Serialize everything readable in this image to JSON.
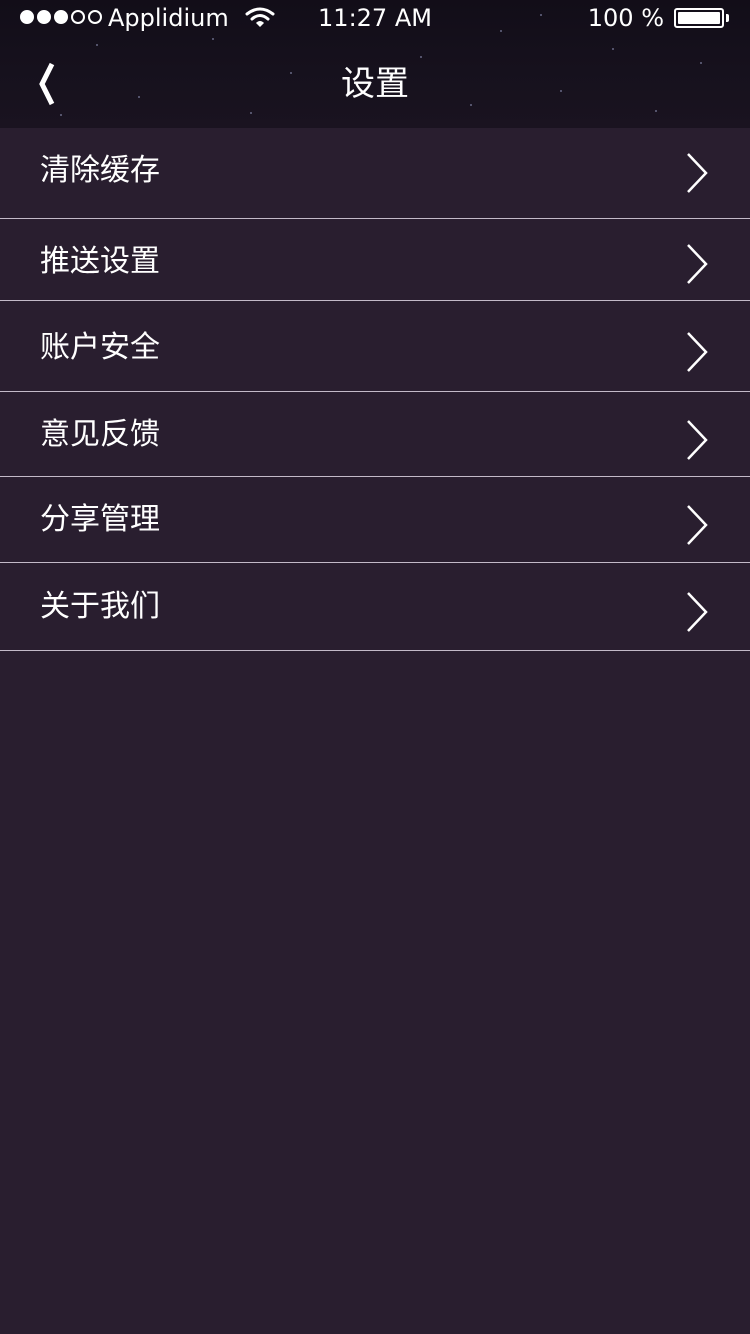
{
  "status_bar": {
    "carrier": "Applidium",
    "time": "11:27 AM",
    "battery": "100 %",
    "signal_bars_filled": 3,
    "signal_bars_total": 5
  },
  "nav": {
    "title": "设置",
    "back_icon": "chevron-left-icon"
  },
  "menu": {
    "items": [
      {
        "label": "清除缓存",
        "icon": "chevron-right-icon"
      },
      {
        "label": "推送设置",
        "icon": "chevron-right-icon"
      },
      {
        "label": "账户安全",
        "icon": "chevron-right-icon"
      },
      {
        "label": "意见反馈",
        "icon": "chevron-right-icon"
      },
      {
        "label": "分享管理",
        "icon": "chevron-right-icon"
      },
      {
        "label": "关于我们",
        "icon": "chevron-right-icon"
      }
    ]
  },
  "colors": {
    "background": "#291e2f",
    "header": "#16111d",
    "divider": "#c3bac8",
    "text": "#ffffff"
  }
}
